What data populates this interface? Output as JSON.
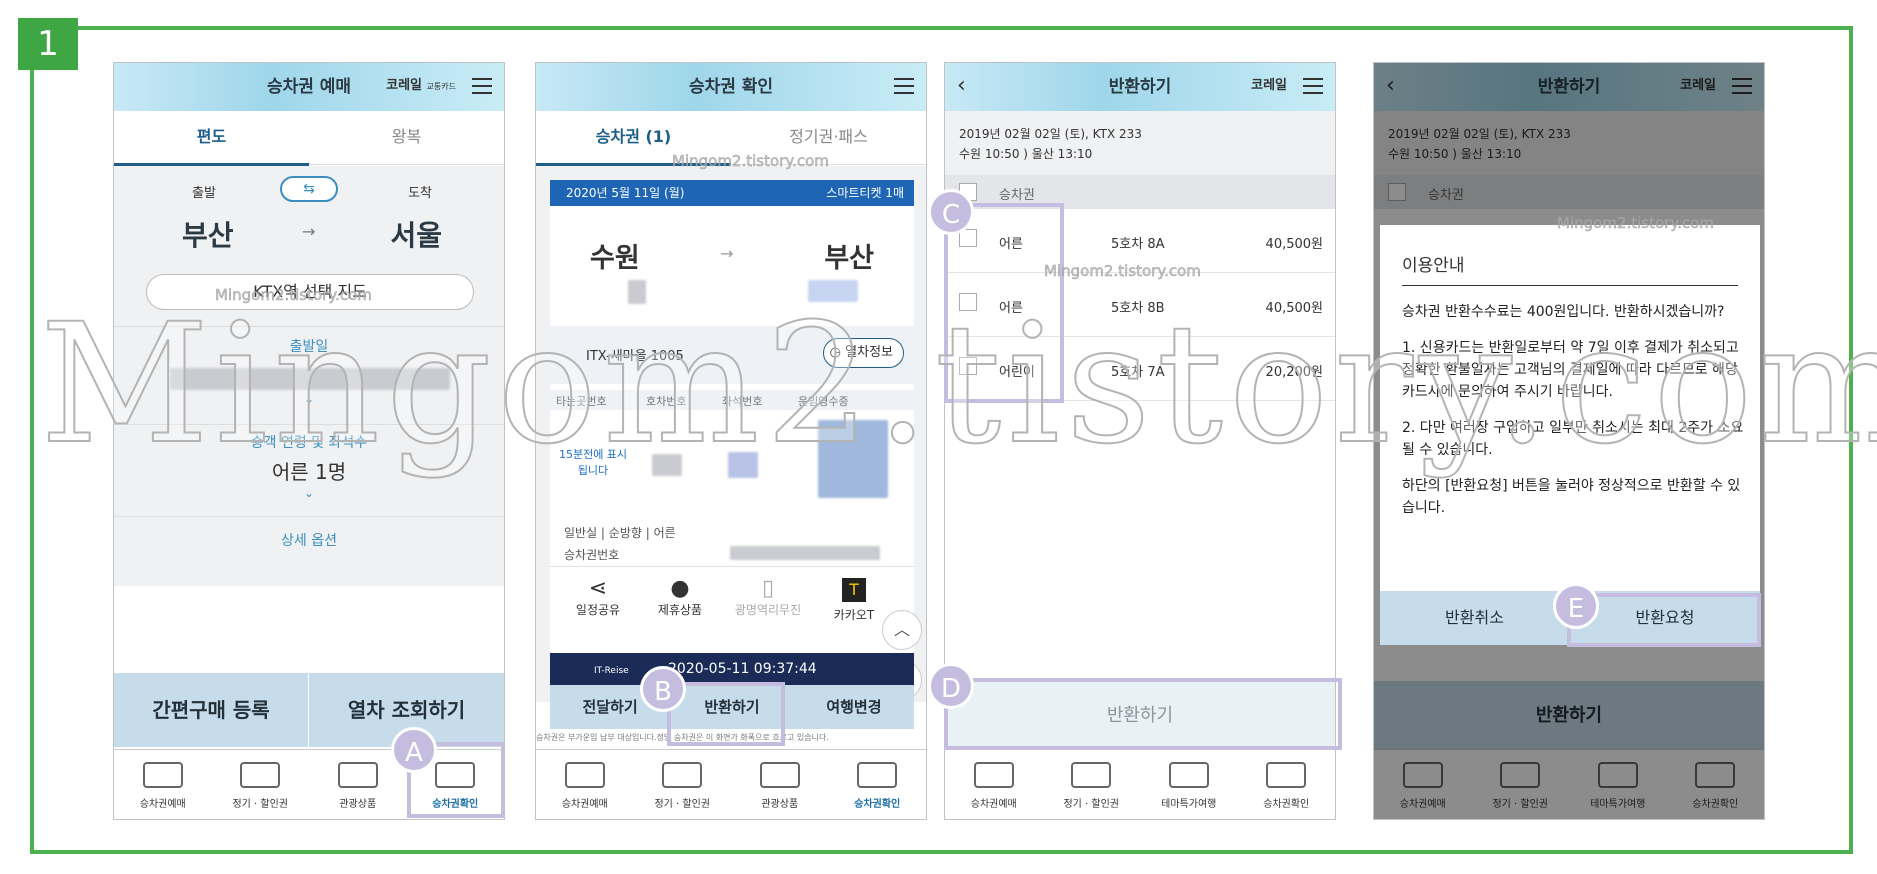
{
  "step_number": "1",
  "markers": [
    "A",
    "B",
    "C",
    "D",
    "E"
  ],
  "watermark": "Mingom2.tistory.com",
  "colors": {
    "frame": "#4caf50",
    "accent": "#1d5f8a",
    "highlight": "#c5bde0"
  },
  "bottom_nav_1": [
    "승차권예매",
    "정기 · 할인권",
    "관광상품",
    "승차권확인"
  ],
  "bottom_nav_2": [
    "승차권예매",
    "정기 · 할인권",
    "관광상품",
    "승차권확인"
  ],
  "bottom_nav_3": [
    "승차권예매",
    "정기 · 할인권",
    "테마특가여행",
    "승차권확인"
  ],
  "screen1": {
    "title": "승차권 예매",
    "logo": "코레일",
    "logo_sub": "교통카드",
    "tabs": [
      "편도",
      "왕복"
    ],
    "depart_label": "출발",
    "arrive_label": "도착",
    "from": "부산",
    "to": "서울",
    "arrow": "→",
    "map_button": "KTX역 선택 지도",
    "date_label": "출발일",
    "passenger_label": "승객 연령 및 좌석수",
    "passenger_value": "어른 1명",
    "detail_option": "상세 옵션",
    "btn_quick": "간편구매 등록",
    "btn_search": "열차 조회하기"
  },
  "screen2": {
    "title": "승차권 확인",
    "tabs": [
      "승차권 (1)",
      "정기권·패스"
    ],
    "date": "2020년 5월 11일 (월)",
    "ticket_type": "스마트티켓 1매",
    "from": "수원",
    "to": "부산",
    "arrow": "→",
    "train": "ITX-새마을 1005",
    "train_info": "열차정보",
    "cols": [
      "타는곳번호",
      "호차번호",
      "좌석번호",
      "운임영수증"
    ],
    "platform_note": "15분전에 표시됩니다",
    "class_info": "일반실 | 순방향 | 어른",
    "ticket_no_label": "승차권번호",
    "actions": [
      "일정공유",
      "제휴상품",
      "광명역리무진",
      "카카오T"
    ],
    "banner_brand": "IT-Reise",
    "banner_time": "2020-05-11 09:37:44",
    "bottom_btns": [
      "전달하기",
      "반환하기",
      "여행변경"
    ],
    "notice": "승차권은 부가운임 납부 대상입니다.정당 승차권은 이 화면가 화폭으로 흐르고 있습니다."
  },
  "screen3": {
    "title": "반환하기",
    "trip_line1": "2019년 02월 02일 (토), KTX 233",
    "trip_line2": "수원 10:50 ) 울산 13:10",
    "header_check": "승차권",
    "rows": [
      {
        "type": "어른",
        "seat": "5호차 8A",
        "price": "40,500원"
      },
      {
        "type": "어른",
        "seat": "5호차 8B",
        "price": "40,500원"
      },
      {
        "type": "어린이",
        "seat": "5호차 7A",
        "price": "20,200원"
      }
    ],
    "refund_button": "반환하기"
  },
  "screen4": {
    "title": "반환하기",
    "trip_line1": "2019년 02월 02일 (토), KTX 233",
    "trip_line2": "수원 10:50 ) 울산 13:10",
    "header_check": "승차권",
    "dialog_title": "이용안내",
    "dialog_p1": "승차권 반환수수료는 400원입니다. 반환하시겠습니까?",
    "dialog_p2": "1. 신용카드는 반환일로부터 약 7일 이후 결제가 취소되고 정확한 환불일자는 고객님의 결제일에 따라 다르므로 해당 카드사에 문의하여 주시기 바랍니다.",
    "dialog_p3": "2. 다만 여러장 구입하고 일부만 취소시는 최대 2주가 소요될 수 있습니다.",
    "dialog_p4": "하단의 [반환요청] 버튼을 눌러야 정상적으로 반환할 수 있습니다.",
    "btn_cancel": "반환취소",
    "btn_request": "반환요청",
    "bottom_button": "반환하기"
  }
}
